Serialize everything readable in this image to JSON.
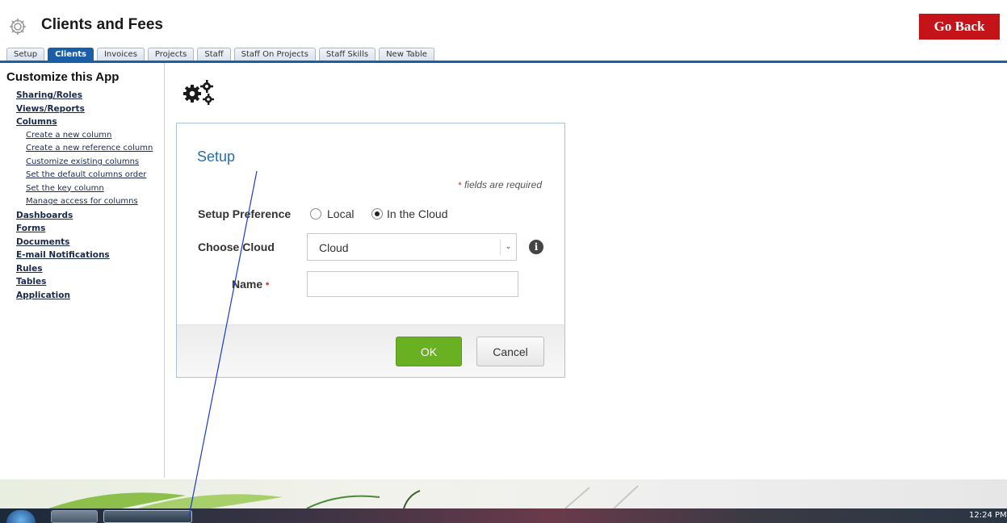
{
  "header": {
    "app_title": "Clients and Fees",
    "go_back_label": "Go Back"
  },
  "tabs": [
    {
      "label": "Setup",
      "active": false
    },
    {
      "label": "Clients",
      "active": true
    },
    {
      "label": "Invoices",
      "active": false
    },
    {
      "label": "Projects",
      "active": false
    },
    {
      "label": "Staff",
      "active": false
    },
    {
      "label": "Staff On Projects",
      "active": false
    },
    {
      "label": "Staff Skills",
      "active": false
    },
    {
      "label": "New Table",
      "active": false
    }
  ],
  "sidebar": {
    "title": "Customize this App",
    "items": [
      {
        "label": "Sharing/Roles",
        "level": "main"
      },
      {
        "label": "Views/Reports",
        "level": "main"
      },
      {
        "label": "Columns",
        "level": "main"
      },
      {
        "label": "Create a new column",
        "level": "sub"
      },
      {
        "label": "Create a new reference column",
        "level": "sub"
      },
      {
        "label": "Customize existing columns",
        "level": "sub"
      },
      {
        "label": "Set the default columns order",
        "level": "sub"
      },
      {
        "label": "Set the key column",
        "level": "sub"
      },
      {
        "label": "Manage access for columns",
        "level": "sub"
      },
      {
        "label": "Dashboards",
        "level": "main"
      },
      {
        "label": "Forms",
        "level": "main"
      },
      {
        "label": "Documents",
        "level": "main"
      },
      {
        "label": "E-mail Notifications",
        "level": "main"
      },
      {
        "label": "Rules",
        "level": "main"
      },
      {
        "label": "Tables",
        "level": "main"
      },
      {
        "label": "Application",
        "level": "main"
      }
    ]
  },
  "dialog": {
    "title": "Setup",
    "required_star": "*",
    "required_note": "fields are required",
    "setup_preference_label": "Setup Preference",
    "option_local": "Local",
    "option_cloud": "In the Cloud",
    "selected_option": "In the Cloud",
    "choose_cloud_label": "Choose Cloud",
    "cloud_value": "Cloud",
    "name_label": "Name",
    "name_value": "",
    "ok_label": "OK",
    "cancel_label": "Cancel"
  },
  "taskbar": {
    "clock": "12:24 PM"
  },
  "icons": {
    "app": "gear-icon",
    "content": "gears-icon",
    "info": "info-icon",
    "dropdown": "chevron-down-icon"
  },
  "colors": {
    "go_back": "#c4141a",
    "tab_active": "#1a5ea8",
    "dialog_title": "#2a6fa8",
    "ok_button": "#6ab023",
    "required": "#d02020"
  }
}
